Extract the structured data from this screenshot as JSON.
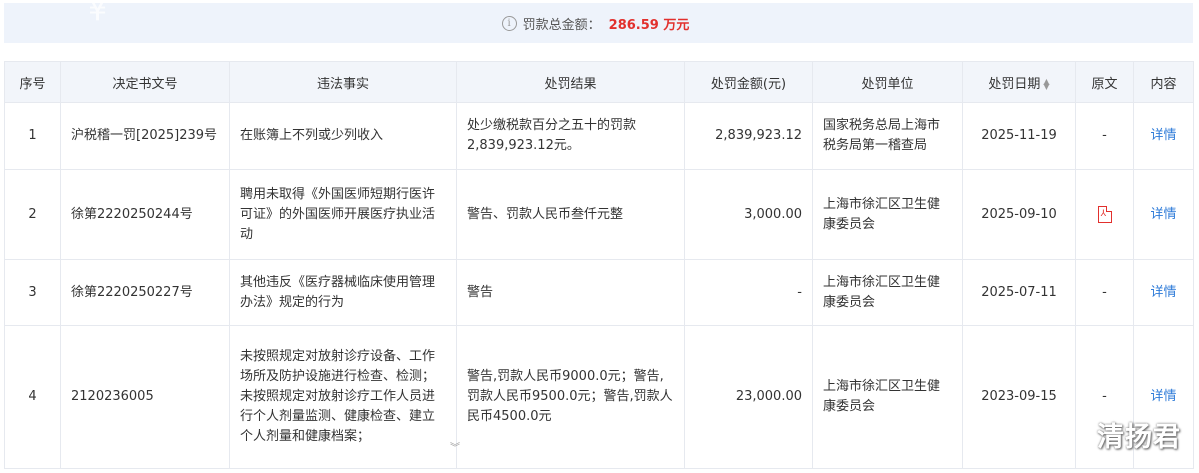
{
  "summary": {
    "label": "罚款总金额：",
    "value": "286.59 万元"
  },
  "table": {
    "headers": {
      "seq": "序号",
      "doc_no": "决定书文号",
      "facts": "违法事实",
      "result": "处罚结果",
      "amount": "处罚金额(元)",
      "unit": "处罚单位",
      "date": "处罚日期",
      "original": "原文",
      "content": "内容"
    },
    "rows": [
      {
        "seq": "1",
        "doc_no": "沪税稽一罚[2025]239号",
        "facts": "在账簿上不列或少列收入",
        "result": "处少缴税款百分之五十的罚款2,839,923.12元。",
        "amount": "2,839,923.12",
        "unit": "国家税务总局上海市税务局第一稽查局",
        "date": "2025-11-19",
        "original": "-",
        "detail": "详情"
      },
      {
        "seq": "2",
        "doc_no": "徐第2220250244号",
        "facts": "聘用未取得《外国医师短期行医许可证》的外国医师开展医疗执业活动",
        "result": "警告、罚款人民币叁仟元整",
        "amount": "3,000.00",
        "unit": "上海市徐汇区卫生健康委员会",
        "date": "2025-09-10",
        "original": "",
        "detail": "详情"
      },
      {
        "seq": "3",
        "doc_no": "徐第2220250227号",
        "facts": "其他违反《医疗器械临床使用管理办法》规定的行为",
        "result": "警告",
        "amount": "-",
        "unit": "上海市徐汇区卫生健康委员会",
        "date": "2025-07-11",
        "original": "-",
        "detail": "详情"
      },
      {
        "seq": "4",
        "doc_no": "2120236005",
        "facts": "未按照规定对放射诊疗设备、工作场所及防护设施进行检查、检测；未按照规定对放射诊疗工作人员进行个人剂量监测、健康检查、建立个人剂量和健康档案；",
        "result": "警告,罚款人民币9000.0元；警告,罚款人民币9500.0元；警告,罚款人民币4500.0元",
        "amount": "23,000.00",
        "unit": "上海市徐汇区卫生健康委员会",
        "date": "2023-09-15",
        "original": "-",
        "detail": "详情"
      }
    ]
  },
  "watermark": "清扬君",
  "icons": {
    "info": "info-circle-icon",
    "sort": "sort-icon",
    "pdf": "pdf-file-icon",
    "expand": "chevron-double-down-icon"
  },
  "colors": {
    "accent_red": "#e2302d",
    "link_blue": "#2e7bd8",
    "header_bg": "#f2f5fa",
    "summary_bg": "#eef3fb"
  }
}
